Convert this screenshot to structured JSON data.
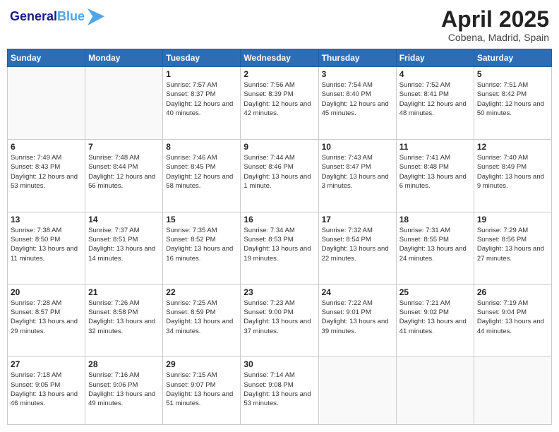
{
  "header": {
    "logo_line1": "General",
    "logo_line2": "Blue",
    "month_title": "April 2025",
    "location": "Cobena, Madrid, Spain"
  },
  "weekdays": [
    "Sunday",
    "Monday",
    "Tuesday",
    "Wednesday",
    "Thursday",
    "Friday",
    "Saturday"
  ],
  "weeks": [
    [
      {
        "day": "",
        "info": ""
      },
      {
        "day": "",
        "info": ""
      },
      {
        "day": "1",
        "info": "Sunrise: 7:57 AM\nSunset: 8:37 PM\nDaylight: 12 hours and 40 minutes."
      },
      {
        "day": "2",
        "info": "Sunrise: 7:56 AM\nSunset: 8:39 PM\nDaylight: 12 hours and 42 minutes."
      },
      {
        "day": "3",
        "info": "Sunrise: 7:54 AM\nSunset: 8:40 PM\nDaylight: 12 hours and 45 minutes."
      },
      {
        "day": "4",
        "info": "Sunrise: 7:52 AM\nSunset: 8:41 PM\nDaylight: 12 hours and 48 minutes."
      },
      {
        "day": "5",
        "info": "Sunrise: 7:51 AM\nSunset: 8:42 PM\nDaylight: 12 hours and 50 minutes."
      }
    ],
    [
      {
        "day": "6",
        "info": "Sunrise: 7:49 AM\nSunset: 8:43 PM\nDaylight: 12 hours and 53 minutes."
      },
      {
        "day": "7",
        "info": "Sunrise: 7:48 AM\nSunset: 8:44 PM\nDaylight: 12 hours and 56 minutes."
      },
      {
        "day": "8",
        "info": "Sunrise: 7:46 AM\nSunset: 8:45 PM\nDaylight: 12 hours and 58 minutes."
      },
      {
        "day": "9",
        "info": "Sunrise: 7:44 AM\nSunset: 8:46 PM\nDaylight: 13 hours and 1 minute."
      },
      {
        "day": "10",
        "info": "Sunrise: 7:43 AM\nSunset: 8:47 PM\nDaylight: 13 hours and 3 minutes."
      },
      {
        "day": "11",
        "info": "Sunrise: 7:41 AM\nSunset: 8:48 PM\nDaylight: 13 hours and 6 minutes."
      },
      {
        "day": "12",
        "info": "Sunrise: 7:40 AM\nSunset: 8:49 PM\nDaylight: 13 hours and 9 minutes."
      }
    ],
    [
      {
        "day": "13",
        "info": "Sunrise: 7:38 AM\nSunset: 8:50 PM\nDaylight: 13 hours and 11 minutes."
      },
      {
        "day": "14",
        "info": "Sunrise: 7:37 AM\nSunset: 8:51 PM\nDaylight: 13 hours and 14 minutes."
      },
      {
        "day": "15",
        "info": "Sunrise: 7:35 AM\nSunset: 8:52 PM\nDaylight: 13 hours and 16 minutes."
      },
      {
        "day": "16",
        "info": "Sunrise: 7:34 AM\nSunset: 8:53 PM\nDaylight: 13 hours and 19 minutes."
      },
      {
        "day": "17",
        "info": "Sunrise: 7:32 AM\nSunset: 8:54 PM\nDaylight: 13 hours and 22 minutes."
      },
      {
        "day": "18",
        "info": "Sunrise: 7:31 AM\nSunset: 8:55 PM\nDaylight: 13 hours and 24 minutes."
      },
      {
        "day": "19",
        "info": "Sunrise: 7:29 AM\nSunset: 8:56 PM\nDaylight: 13 hours and 27 minutes."
      }
    ],
    [
      {
        "day": "20",
        "info": "Sunrise: 7:28 AM\nSunset: 8:57 PM\nDaylight: 13 hours and 29 minutes."
      },
      {
        "day": "21",
        "info": "Sunrise: 7:26 AM\nSunset: 8:58 PM\nDaylight: 13 hours and 32 minutes."
      },
      {
        "day": "22",
        "info": "Sunrise: 7:25 AM\nSunset: 8:59 PM\nDaylight: 13 hours and 34 minutes."
      },
      {
        "day": "23",
        "info": "Sunrise: 7:23 AM\nSunset: 9:00 PM\nDaylight: 13 hours and 37 minutes."
      },
      {
        "day": "24",
        "info": "Sunrise: 7:22 AM\nSunset: 9:01 PM\nDaylight: 13 hours and 39 minutes."
      },
      {
        "day": "25",
        "info": "Sunrise: 7:21 AM\nSunset: 9:02 PM\nDaylight: 13 hours and 41 minutes."
      },
      {
        "day": "26",
        "info": "Sunrise: 7:19 AM\nSunset: 9:04 PM\nDaylight: 13 hours and 44 minutes."
      }
    ],
    [
      {
        "day": "27",
        "info": "Sunrise: 7:18 AM\nSunset: 9:05 PM\nDaylight: 13 hours and 46 minutes."
      },
      {
        "day": "28",
        "info": "Sunrise: 7:16 AM\nSunset: 9:06 PM\nDaylight: 13 hours and 49 minutes."
      },
      {
        "day": "29",
        "info": "Sunrise: 7:15 AM\nSunset: 9:07 PM\nDaylight: 13 hours and 51 minutes."
      },
      {
        "day": "30",
        "info": "Sunrise: 7:14 AM\nSunset: 9:08 PM\nDaylight: 13 hours and 53 minutes."
      },
      {
        "day": "",
        "info": ""
      },
      {
        "day": "",
        "info": ""
      },
      {
        "day": "",
        "info": ""
      }
    ]
  ]
}
